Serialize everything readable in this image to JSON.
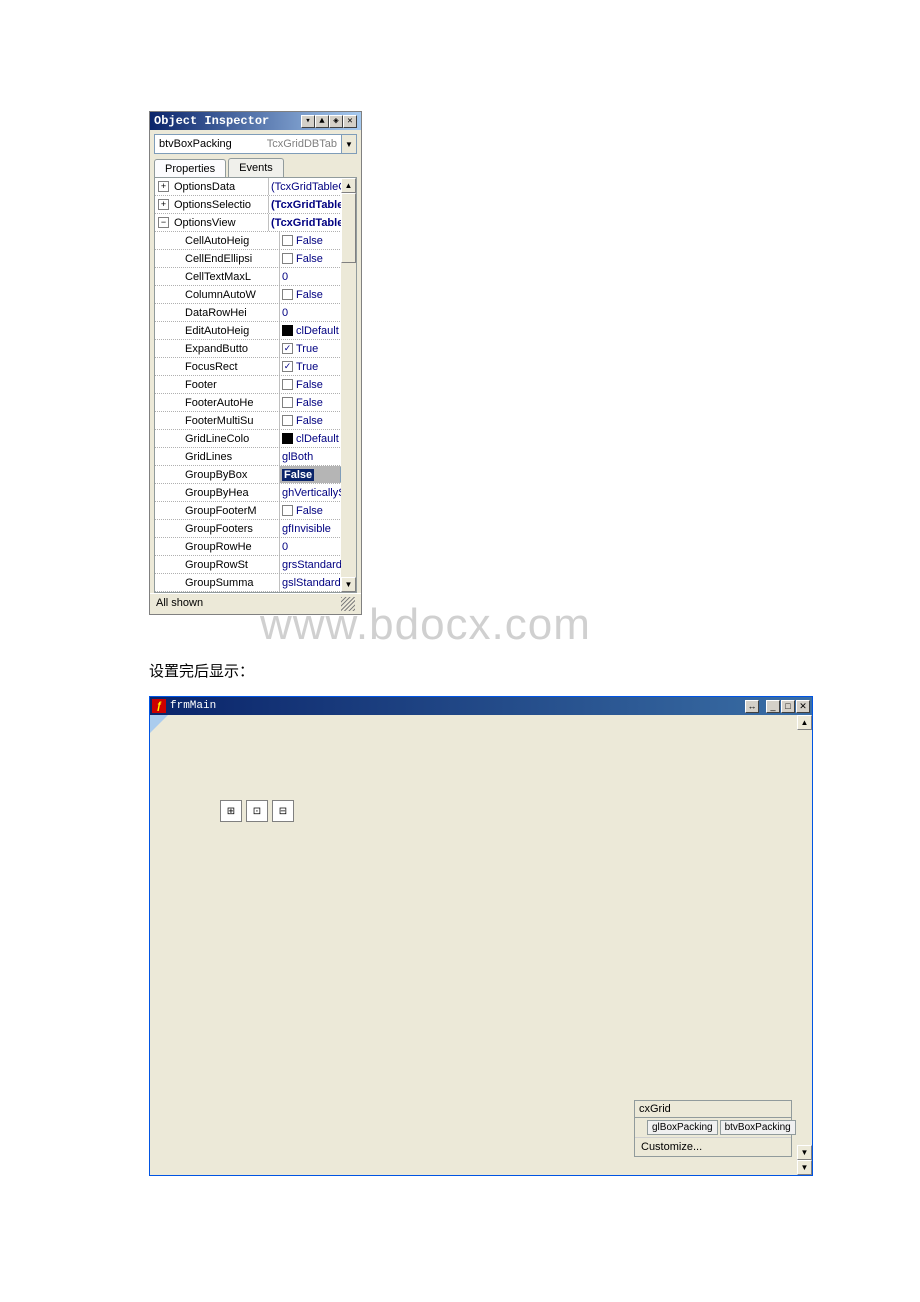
{
  "objectInspector": {
    "title": "Object Inspector",
    "titleButtons": [
      "▾",
      "▲",
      "◈",
      "✕"
    ],
    "comboName": "btvBoxPacking",
    "comboType": "TcxGridDBTab",
    "tabs": {
      "properties": "Properties",
      "events": "Events"
    },
    "rows": [
      {
        "expand": "plus",
        "name": "OptionsData",
        "value": "(TcxGridTableO",
        "type": "text"
      },
      {
        "expand": "plus",
        "name": "OptionsSelectio",
        "value": "(TcxGridTable",
        "type": "text",
        "bold": true
      },
      {
        "expand": "minus",
        "name": "OptionsView",
        "value": "(TcxGridTable",
        "type": "text",
        "bold": true
      },
      {
        "expand": "none",
        "indent": 1,
        "name": "CellAutoHeig",
        "value": "False",
        "type": "check",
        "checked": false
      },
      {
        "expand": "none",
        "indent": 1,
        "name": "CellEndEllipsi",
        "value": "False",
        "type": "check",
        "checked": false
      },
      {
        "expand": "none",
        "indent": 1,
        "name": "CellTextMaxL",
        "value": "0",
        "type": "text"
      },
      {
        "expand": "none",
        "indent": 1,
        "name": "ColumnAutoW",
        "value": "False",
        "type": "check",
        "checked": false
      },
      {
        "expand": "none",
        "indent": 1,
        "name": "DataRowHei",
        "value": "0",
        "type": "text"
      },
      {
        "expand": "none",
        "indent": 1,
        "name": "EditAutoHeig",
        "value": "clDefault",
        "type": "color"
      },
      {
        "expand": "none",
        "indent": 1,
        "name": "ExpandButto",
        "value": "True",
        "type": "check",
        "checked": true
      },
      {
        "expand": "none",
        "indent": 1,
        "name": "FocusRect",
        "value": "True",
        "type": "check",
        "checked": true
      },
      {
        "expand": "none",
        "indent": 1,
        "name": "Footer",
        "value": "False",
        "type": "check",
        "checked": false
      },
      {
        "expand": "none",
        "indent": 1,
        "name": "FooterAutoHe",
        "value": "False",
        "type": "check",
        "checked": false
      },
      {
        "expand": "none",
        "indent": 1,
        "name": "FooterMultiSu",
        "value": "False",
        "type": "check",
        "checked": false
      },
      {
        "expand": "none",
        "indent": 1,
        "name": "GridLineColo",
        "value": "clDefault",
        "type": "color"
      },
      {
        "expand": "none",
        "indent": 1,
        "name": "GridLines",
        "value": "glBoth",
        "type": "text"
      },
      {
        "expand": "none",
        "indent": 1,
        "name": "GroupByBox",
        "value": "False",
        "type": "dropdown",
        "selected": true
      },
      {
        "expand": "none",
        "indent": 1,
        "name": "GroupByHea",
        "value": "ghVerticallyShift",
        "type": "text"
      },
      {
        "expand": "none",
        "indent": 1,
        "name": "GroupFooterM",
        "value": "False",
        "type": "check",
        "checked": false
      },
      {
        "expand": "none",
        "indent": 1,
        "name": "GroupFooters",
        "value": "gfInvisible",
        "type": "text"
      },
      {
        "expand": "none",
        "indent": 1,
        "name": "GroupRowHe",
        "value": "0",
        "type": "text"
      },
      {
        "expand": "none",
        "indent": 1,
        "name": "GroupRowSt",
        "value": "grsStandard",
        "type": "text"
      },
      {
        "expand": "none",
        "indent": 1,
        "name": "GroupSumma",
        "value": "gslStandard",
        "type": "text"
      }
    ],
    "status": "All shown"
  },
  "watermark": "www.bdocx.com",
  "caption": "设置完后显示：",
  "designer": {
    "title": "frmMain",
    "titleButtons": {
      "stay": "↔",
      "min": "_",
      "max": "□",
      "close": "✕"
    },
    "toolIcons": [
      "⊞",
      "⊡",
      "⊟"
    ],
    "gridPanel": {
      "title": "cxGrid",
      "level": "glBoxPacking",
      "view": "btvBoxPacking",
      "customize": "Customize..."
    }
  }
}
